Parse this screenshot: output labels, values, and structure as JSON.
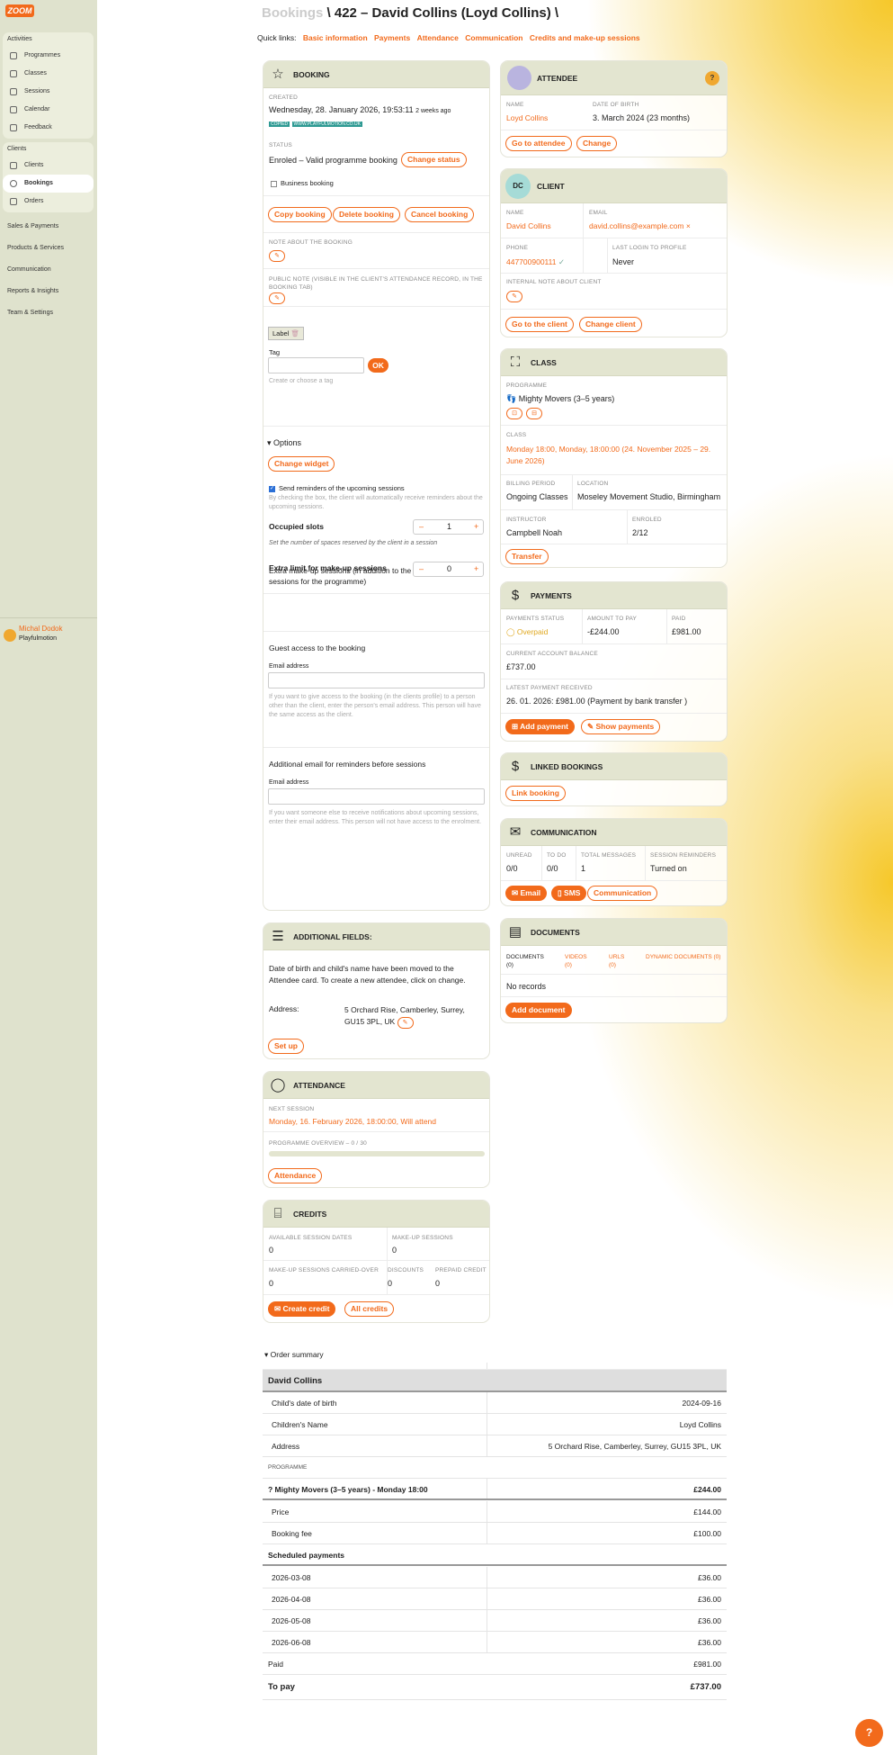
{
  "app": {
    "logo": "ZOOM"
  },
  "sidebar": {
    "activities_head": "Activities",
    "activities": [
      {
        "label": "Programmes"
      },
      {
        "label": "Classes"
      },
      {
        "label": "Sessions"
      },
      {
        "label": "Calendar"
      },
      {
        "label": "Feedback"
      }
    ],
    "clients_head": "Clients",
    "clients": [
      {
        "label": "Clients"
      },
      {
        "label": "Bookings"
      },
      {
        "label": "Orders"
      }
    ],
    "plain": [
      "Sales & Payments",
      "Products & Services",
      "Communication",
      "Reports & Insights",
      "Team & Settings"
    ],
    "user": {
      "name": "Michal Dodok",
      "company": "Playfulmotion"
    }
  },
  "header": {
    "crumb": "Bookings",
    "title": "\\ 422 – David Collins (Loyd Collins) \\",
    "quick_label": "Quick links:",
    "quick": [
      "Basic information",
      "Payments",
      "Attendance",
      "Communication",
      "Credits and make-up sessions"
    ]
  },
  "booking": {
    "title": "BOOKING",
    "created_label": "CREATED",
    "created": "Wednesday, 28. January 2026, 19:53:11",
    "created_ago": "2 weeks ago",
    "tag1": "COPIED",
    "tag2": "WWW.PLAYFULMOTION.CO.UK",
    "status_label": "STATUS",
    "status": "Enroled – Valid programme booking",
    "change_status": "Change status",
    "business": "Business booking",
    "copy": "Copy booking",
    "delete": "Delete booking",
    "cancel": "Cancel booking",
    "note_label": "NOTE ABOUT THE BOOKING",
    "public_note_label": "PUBLIC NOTE (VISIBLE IN THE CLIENT'S ATTENDANCE RECORD, IN THE BOOKING TAB)",
    "label_chip": "Label",
    "tag_label": "Tag",
    "ok": "OK",
    "tag_hint": "Create or choose a tag",
    "options": "Options",
    "change_widget": "Change widget",
    "reminders": "Send reminders of the upcoming sessions",
    "reminders_hint": "By checking the box, the client will automatically receive reminders about the upcoming sessions.",
    "occupied_label": "Occupied slots",
    "occupied_value": "1",
    "occupied_hint": "Set the number of spaces reserved by the client in a session",
    "extra_text": "Extra make-up sessions (in addition to the limit for make-up sessions for the programme)",
    "extra_label": "Extra limit for make-up sessions",
    "extra_value": "0",
    "guest_title": "Guest access to the booking",
    "email_label": "Email address",
    "guest_hint": "If you want to give access to the booking (in the clients profile) to a person other than the client, enter the person's email address. This person will have the same access as the client.",
    "addl_title": "Additional email for reminders before sessions",
    "email_label2": "Email address",
    "addl_hint": "If you want someone else to receive notifications about upcoming sessions, enter their email address. This person will not have access to the enrolment."
  },
  "additional": {
    "title": "ADDITIONAL FIELDS:",
    "text": "Date of birth and child's name have been moved to the Attendee card. To create a new attendee, click on change.",
    "address_label": "Address:",
    "address": "5 Orchard Rise, Camberley, Surrey, GU15 3PL, UK",
    "setup": "Set up"
  },
  "attendance": {
    "title": "ATTENDANCE",
    "next_label": "NEXT SESSION",
    "next": "Monday, 16. February 2026, 18:00:00, Will attend",
    "overview_label": "PROGRAMME OVERVIEW – 0 / 30",
    "progress": 0,
    "btn": "Attendance"
  },
  "credits": {
    "title": "CREDITS",
    "available_label": "AVAILABLE SESSION DATES",
    "available": "0",
    "makeup_label": "MAKE-UP SESSIONS",
    "makeup": "0",
    "carried_label": "MAKE-UP SESSIONS CARRIED-OVER",
    "carried": "0",
    "discounts_label": "DISCOUNTS",
    "discounts": "0",
    "prepaid_label": "PREPAID CREDIT",
    "prepaid": "0",
    "create": "Create credit",
    "all": "All credits"
  },
  "attendee": {
    "title": "ATTENDEE",
    "help": "?",
    "name_label": "NAME",
    "name": "Loyd Collins",
    "dob_label": "DATE OF BIRTH",
    "dob": "3. March 2024 (23 months)",
    "go": "Go to attendee",
    "change": "Change"
  },
  "client": {
    "title": "CLIENT",
    "initials": "DC",
    "name_label": "NAME",
    "name": "David Collins",
    "email_label": "EMAIL",
    "email": "david.collins@example.com",
    "phone_label": "PHONE",
    "phone": "447700900111",
    "login_label": "LAST LOGIN TO PROFILE",
    "login": "Never",
    "note_label": "INTERNAL NOTE ABOUT CLIENT",
    "go": "Go to the client",
    "change": "Change client"
  },
  "class": {
    "title": "CLASS",
    "programme_label": "PROGRAMME",
    "programme": "Mighty Movers (3–5 years)",
    "class_label": "CLASS",
    "class": "Monday 18:00, Monday, 18:00:00 (24. November 2025 – 29. June 2026)",
    "billing_label": "BILLING PERIOD",
    "billing": "Ongoing Classes",
    "location_label": "LOCATION",
    "location": "Moseley Movement Studio, Birmingham",
    "instructor_label": "INSTRUCTOR",
    "instructor": "Campbell Noah",
    "enroled_label": "ENROLED",
    "enroled": "2/12",
    "transfer": "Transfer"
  },
  "payments": {
    "title": "PAYMENTS",
    "status_label": "PAYMENTS STATUS",
    "status": "Overpaid",
    "amount_label": "AMOUNT TO PAY",
    "amount": "-£244.00",
    "paid_label": "PAID",
    "paid": "£981.00",
    "balance_label": "CURRENT ACCOUNT BALANCE",
    "balance": "£737.00",
    "latest_label": "LATEST PAYMENT RECEIVED",
    "latest": "26. 01. 2026: £981.00 (Payment by bank transfer )",
    "add": "Add payment",
    "show": "Show payments"
  },
  "linked": {
    "title": "LINKED BOOKINGS",
    "btn": "Link booking"
  },
  "communication": {
    "title": "COMMUNICATION",
    "unread_label": "UNREAD",
    "unread": "0/0",
    "todo_label": "TO DO",
    "todo": "0/0",
    "total_label": "TOTAL MESSAGES",
    "total": "1",
    "reminders_label": "SESSION REMINDERS",
    "reminders": "Turned on",
    "email": "Email",
    "sms": "SMS",
    "comm": "Communication"
  },
  "documents": {
    "title": "DOCUMENTS",
    "tabs": [
      "DOCUMENTS (0)",
      "VIDEOS (0)",
      "URLS (0)",
      "DYNAMIC DOCUMENTS (0)"
    ],
    "empty": "No records",
    "add": "Add document"
  },
  "order": {
    "toggle": "Order summary",
    "client": "David Collins",
    "rows1": [
      {
        "l": "Child's date of birth",
        "r": "2024-09-16"
      },
      {
        "l": "Children's Name",
        "r": "Loyd Collins"
      },
      {
        "l": "Address",
        "r": "5 Orchard Rise, Camberley, Surrey, GU15 3PL, UK"
      }
    ],
    "programme_head": "PROGRAMME",
    "programme": "? Mighty Movers (3–5 years) - Monday 18:00",
    "programme_total": "£244.00",
    "rows2": [
      {
        "l": "Price",
        "r": "£144.00"
      },
      {
        "l": "Booking fee",
        "r": "£100.00"
      }
    ],
    "scheduled_head": "Scheduled payments",
    "scheduled": [
      {
        "l": "2026-03-08",
        "r": "£36.00"
      },
      {
        "l": "2026-04-08",
        "r": "£36.00"
      },
      {
        "l": "2026-05-08",
        "r": "£36.00"
      },
      {
        "l": "2026-06-08",
        "r": "£36.00"
      }
    ],
    "paid_label": "Paid",
    "paid": "£981.00",
    "topay_label": "To pay",
    "topay": "£737.00"
  },
  "help_btn": "?"
}
